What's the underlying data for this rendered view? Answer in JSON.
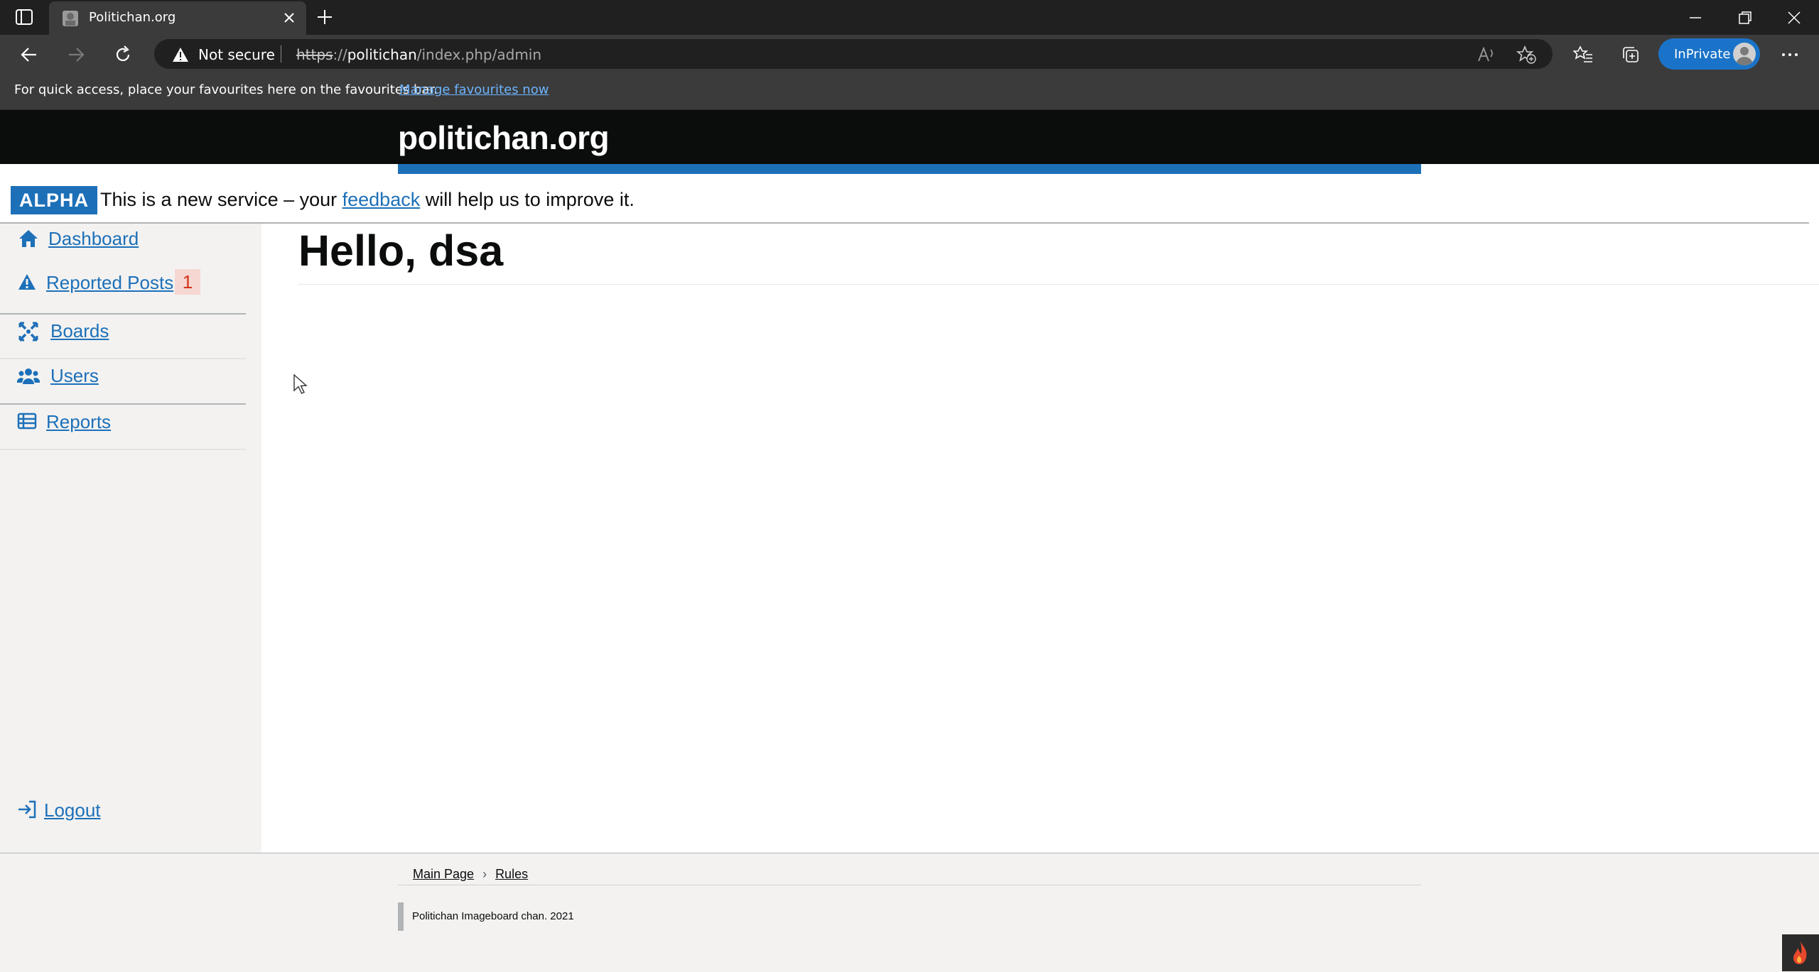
{
  "browser": {
    "tab_title": "Politichan.org",
    "security_label": "Not secure",
    "url_scheme": "https",
    "url_sep": "://",
    "url_host": "politichan",
    "url_path": "/index.php/admin",
    "inprivate_label": "InPrivate",
    "favbar_text": "For quick access, place your favourites here on the favourites bar.",
    "favbar_link": "Manage favourites now"
  },
  "site": {
    "logo": "politichan.org",
    "phase_tag": "ALPHA",
    "phase_text_before": "This is a new service – your ",
    "phase_link": "feedback",
    "phase_text_after": " will help us to improve it."
  },
  "sidebar": {
    "items": [
      {
        "label": "Dashboard",
        "icon": "home-icon"
      },
      {
        "label": "Reported Posts",
        "icon": "warning-icon",
        "badge": "1"
      },
      {
        "label": "Boards",
        "icon": "boards-icon"
      },
      {
        "label": "Users",
        "icon": "users-icon"
      },
      {
        "label": "Reports",
        "icon": "table-icon"
      }
    ],
    "logout_label": "Logout"
  },
  "main": {
    "heading": "Hello, dsa"
  },
  "footer": {
    "crumbs": [
      "Main Page",
      "Rules"
    ],
    "note": "Politichan Imageboard chan. 2021"
  },
  "colors": {
    "link": "#1d70b8",
    "header_bg": "#0b0c0c",
    "sidebar_bg": "#f3f2f1",
    "badge_bg": "#f6d7d2",
    "badge_text": "#d4351c",
    "inprivate": "#1a73c8"
  }
}
